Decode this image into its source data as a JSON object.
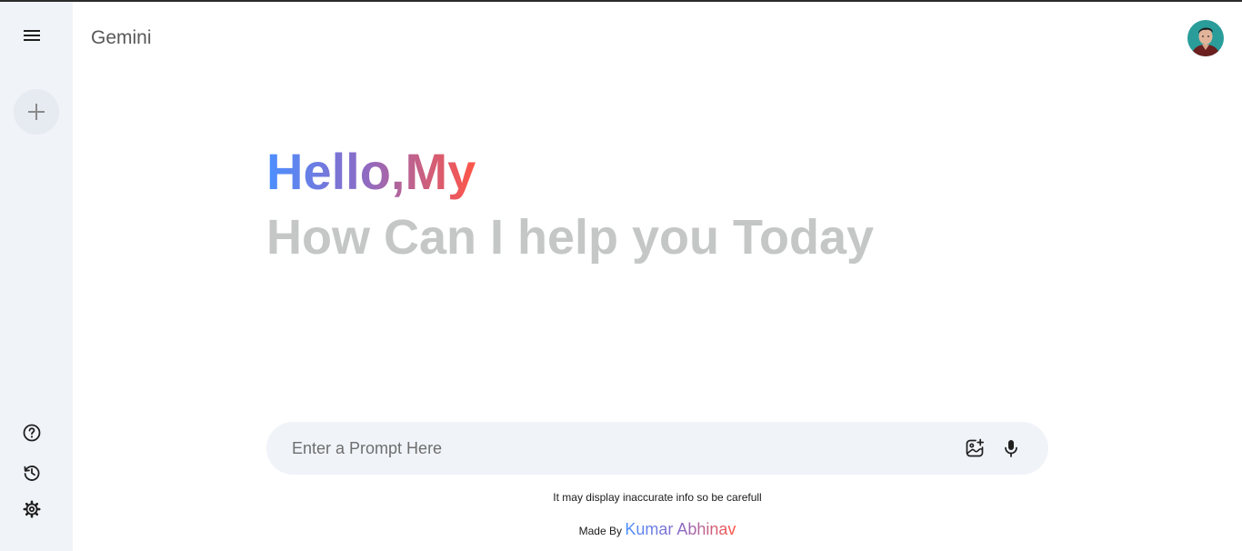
{
  "app": {
    "brand": "Gemini"
  },
  "greeting": {
    "hello": "Hello,My",
    "subtitle": "How Can I help you Today"
  },
  "prompt": {
    "placeholder": "Enter a Prompt Here",
    "value": ""
  },
  "footer": {
    "disclaimer": "It may display inaccurate info so be carefull",
    "made_by_label": "Made By",
    "author": "Kumar Abhinav"
  },
  "icons": {
    "menu": "menu-icon",
    "new_chat": "plus-icon",
    "help": "help-icon",
    "history": "history-icon",
    "settings": "gear-icon",
    "gallery": "gallery-add-icon",
    "mic": "mic-icon"
  },
  "colors": {
    "sidebar_bg": "#f0f4f9",
    "gradient_start": "#4b90ff",
    "gradient_end": "#ff5546",
    "subtitle": "#c4c7c5"
  }
}
